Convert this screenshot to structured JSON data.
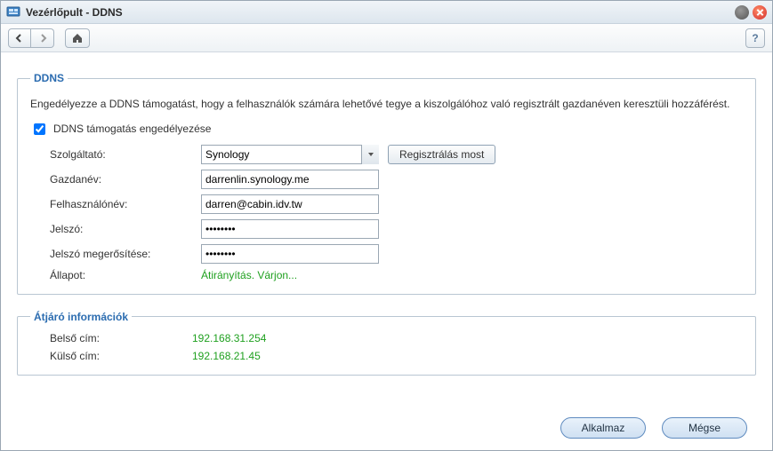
{
  "window": {
    "title": "Vezérlőpult - DDNS"
  },
  "ddns": {
    "legend": "DDNS",
    "description": "Engedélyezze a DDNS támogatást, hogy a felhasználók számára lehetővé tegye a kiszolgálóhoz való regisztrált gazdanéven keresztüli hozzáférést.",
    "enable_label": "DDNS támogatás engedélyezése",
    "enable_checked": true,
    "fields": {
      "provider_label": "Szolgáltató:",
      "provider_value": "Synology",
      "register_now": "Regisztrálás most",
      "hostname_label": "Gazdanév:",
      "hostname_value": "darrenlin.synology.me",
      "username_label": "Felhasználónév:",
      "username_value": "darren@cabin.idv.tw",
      "password_label": "Jelszó:",
      "password_value": "••••••••",
      "password_confirm_label": "Jelszó megerősítése:",
      "password_confirm_value": "••••••••",
      "status_label": "Állapot:",
      "status_value": "Átirányítás. Várjon..."
    }
  },
  "gateway": {
    "legend": "Átjáró információk",
    "internal_label": "Belső cím:",
    "internal_value": "192.168.31.254",
    "external_label": "Külső cím:",
    "external_value": "192.168.21.45"
  },
  "footer": {
    "apply": "Alkalmaz",
    "cancel": "Mégse"
  }
}
